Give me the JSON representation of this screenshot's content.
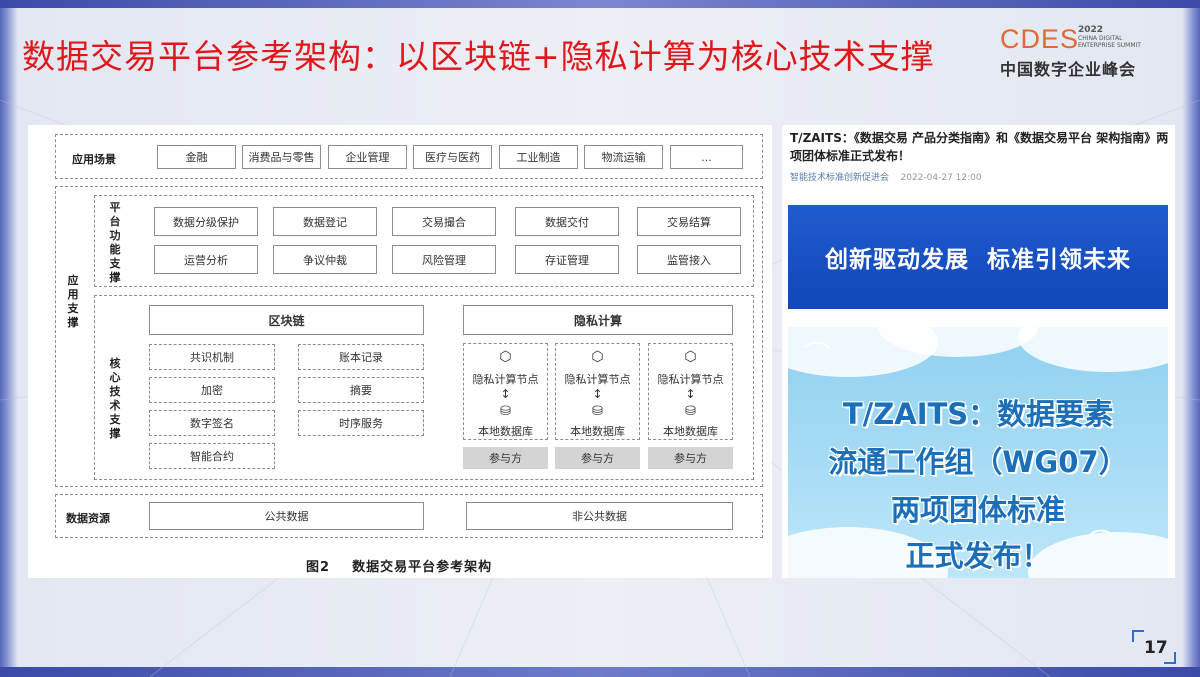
{
  "slide": {
    "title": "数据交易平台参考架构：以区块链+隐私计算为核心技术支撑",
    "page_number": "17"
  },
  "logo": {
    "brand": "CDES",
    "year": "2022",
    "sub": "CHINA DIGITAL ENTERPRISE SUMMIT",
    "cn": "中国数字企业峰会"
  },
  "diagram": {
    "app_scene": {
      "label": "应用场景",
      "items": [
        "金融",
        "消费品与零售",
        "企业管理",
        "医疗与医药",
        "工业制造",
        "物流运输",
        "..."
      ]
    },
    "app_support": {
      "label": "应用支撑"
    },
    "platform": {
      "label": "平台功能支撑",
      "row1": [
        "数据分级保护",
        "数据登记",
        "交易撮合",
        "数据交付",
        "交易结算"
      ],
      "row2": [
        "运营分析",
        "争议仲裁",
        "风险管理",
        "存证管理",
        "监管接入"
      ]
    },
    "core": {
      "label": "核心技术支撑",
      "blockchain": {
        "title": "区块链",
        "left": [
          "共识机制",
          "加密",
          "数字签名",
          "智能合约"
        ],
        "right": [
          "账本记录",
          "摘要",
          "时序服务"
        ]
      },
      "privacy": {
        "title": "隐私计算",
        "node_label": "隐私计算节点",
        "db_label": "本地数据库",
        "party_label": "参与方"
      }
    },
    "data_resource": {
      "label": "数据资源",
      "public": "公共数据",
      "non_public": "非公共数据"
    },
    "caption": "图2    数据交易平台参考架构"
  },
  "article": {
    "title": "T/ZAITS：《数据交易 产品分类指南》和《数据交易平台 架构指南》两项团体标准正式发布！",
    "source": "智能技术标准创新促进会",
    "datetime": "2022-04-27 12:00",
    "banner1": "创新驱动发展  标准引领未来",
    "banner2_lines": [
      "T/ZAITS：数据要素",
      "流通工作组（WG07）",
      "两项团体标准",
      "正式发布！"
    ]
  },
  "colors": {
    "title_red": "#e0181b",
    "banner_blue": "#1f5bd0",
    "sky_blue": "#8fd0f0",
    "accent_blue": "#2a6fd6"
  }
}
